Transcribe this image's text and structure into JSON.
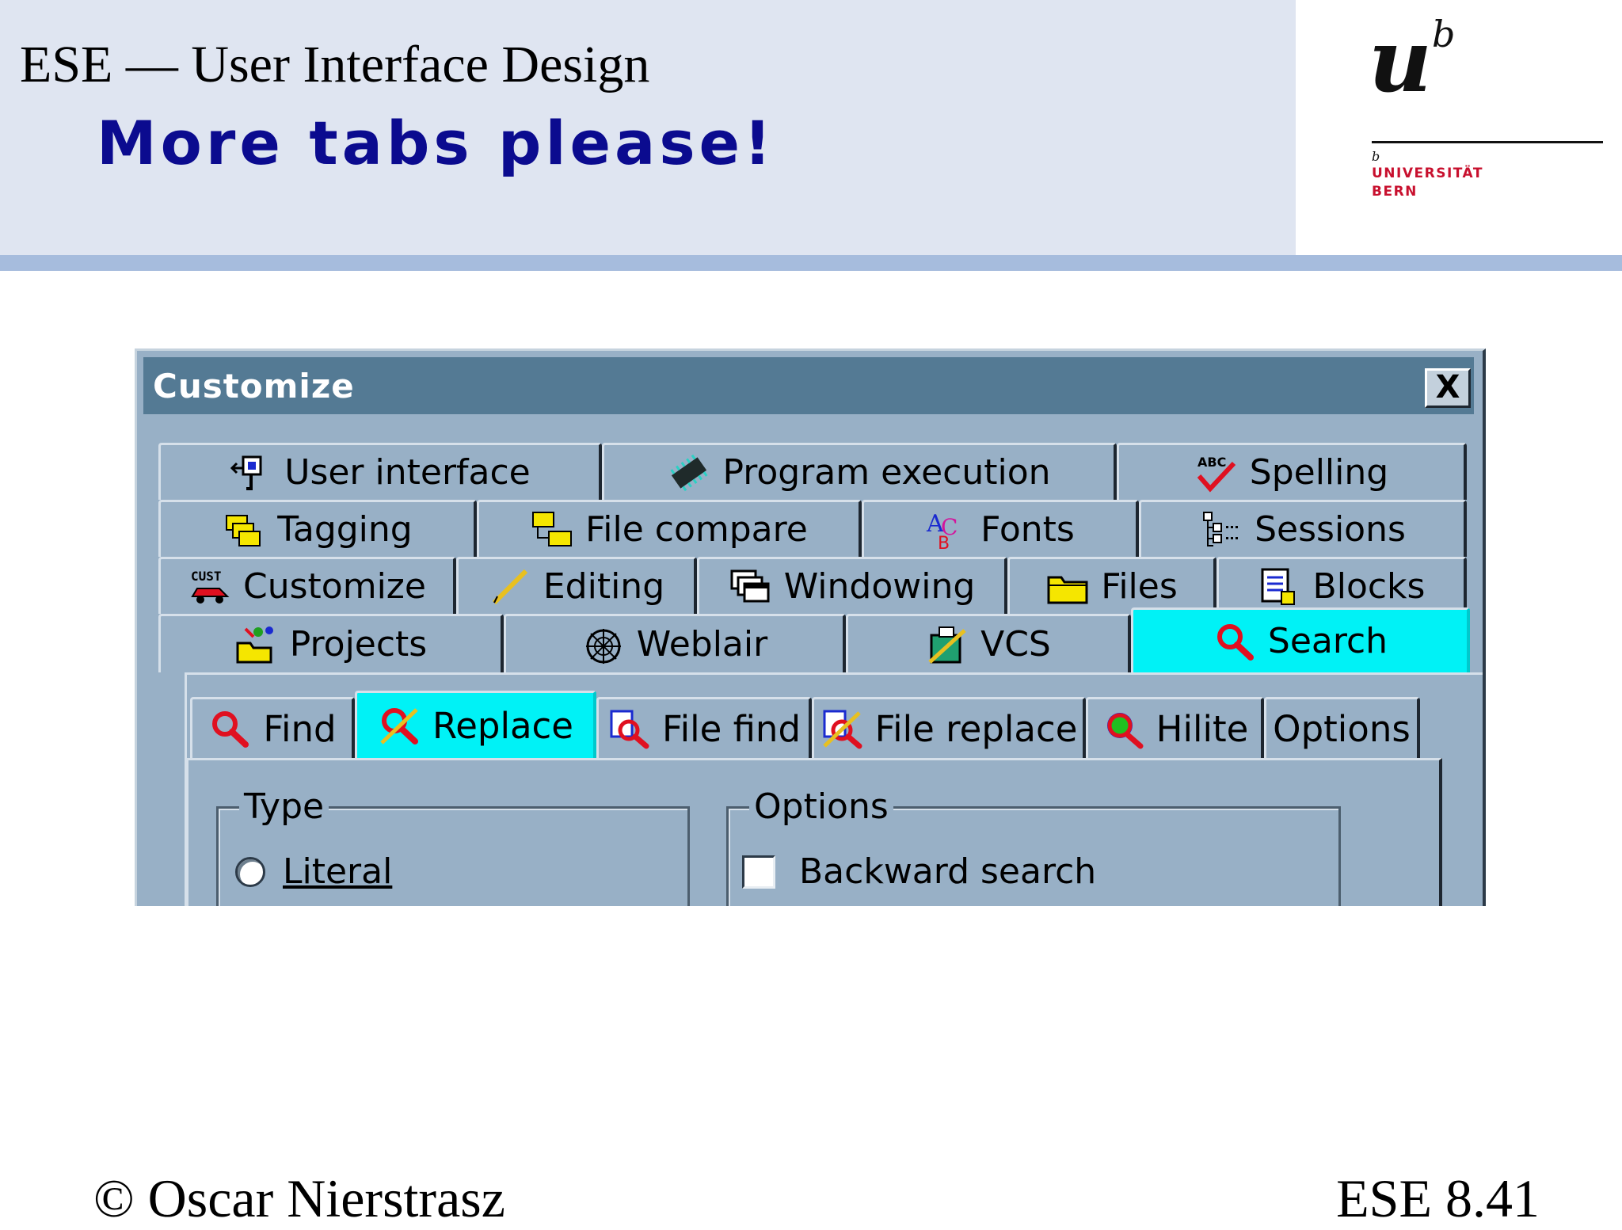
{
  "slide": {
    "course_title": "ESE — User Interface Design",
    "slide_title": "More tabs please!",
    "logo": {
      "u": "u",
      "b": "b",
      "small_b": "b",
      "university": "UNIVERSITÄT",
      "city": "BERN"
    },
    "footer_left": "© Oscar Nierstrasz",
    "footer_right": "ESE 8.41"
  },
  "dialog": {
    "title": "Customize",
    "close_label": "X",
    "main_tabs": {
      "row1": [
        {
          "label": "User interface",
          "icon": "user-interface-icon"
        },
        {
          "label": "Program execution",
          "icon": "chip-icon"
        },
        {
          "label": "Spelling",
          "icon": "spell-check-icon"
        }
      ],
      "row2": [
        {
          "label": "Tagging",
          "icon": "tag-icon"
        },
        {
          "label": "File compare",
          "icon": "folder-compare-icon"
        },
        {
          "label": "Fonts",
          "icon": "fonts-icon"
        },
        {
          "label": "Sessions",
          "icon": "tree-icon"
        }
      ],
      "row3": [
        {
          "label": "Customize",
          "icon": "cust-car-icon"
        },
        {
          "label": "Editing",
          "icon": "pencil-icon"
        },
        {
          "label": "Windowing",
          "icon": "windows-icon"
        },
        {
          "label": "Files",
          "icon": "folder-icon"
        },
        {
          "label": "Blocks",
          "icon": "document-icon"
        }
      ],
      "row4": [
        {
          "label": "Projects",
          "icon": "projects-icon"
        },
        {
          "label": "Weblair",
          "icon": "web-icon"
        },
        {
          "label": "VCS",
          "icon": "vcs-icon"
        },
        {
          "label": "Search",
          "icon": "magnifier-icon",
          "active": true
        }
      ]
    },
    "sub_tabs": [
      {
        "label": "Find",
        "icon": "magnifier-icon"
      },
      {
        "label": "Replace",
        "icon": "replace-icon",
        "active": true
      },
      {
        "label": "File find",
        "icon": "file-find-icon"
      },
      {
        "label": "File replace",
        "icon": "file-replace-icon"
      },
      {
        "label": "Hilite",
        "icon": "hilite-icon"
      },
      {
        "label": "Options",
        "icon": ""
      }
    ],
    "type_group": {
      "legend": "Type",
      "literal_label": "Literal",
      "literal_selected": false
    },
    "options_group": {
      "legend": "Options",
      "backward_label": "Backward search",
      "backward_checked": false
    },
    "colors": {
      "active_tab": "#00f2f6",
      "face": "#98b0c6",
      "titlebar": "#547a94"
    }
  }
}
